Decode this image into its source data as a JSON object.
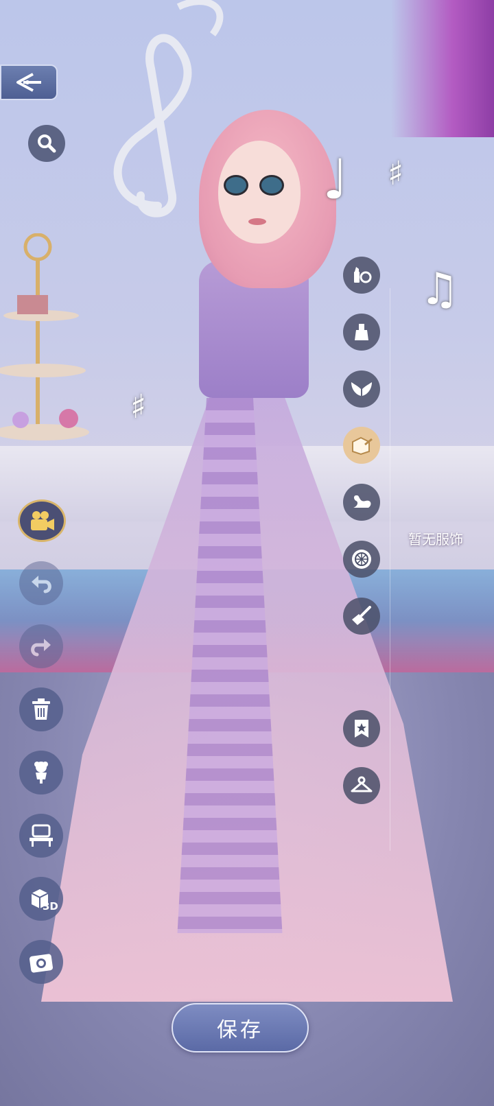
{
  "buttons": {
    "save_label": "保存"
  },
  "status": {
    "no_outfit_text": "暂无服饰"
  },
  "left_toolbar": {
    "view_3d_label": "3D"
  },
  "colors": {
    "panel_button": "#464e6e",
    "save_button": "#6a78b4",
    "film_border": "#d9b56a"
  }
}
